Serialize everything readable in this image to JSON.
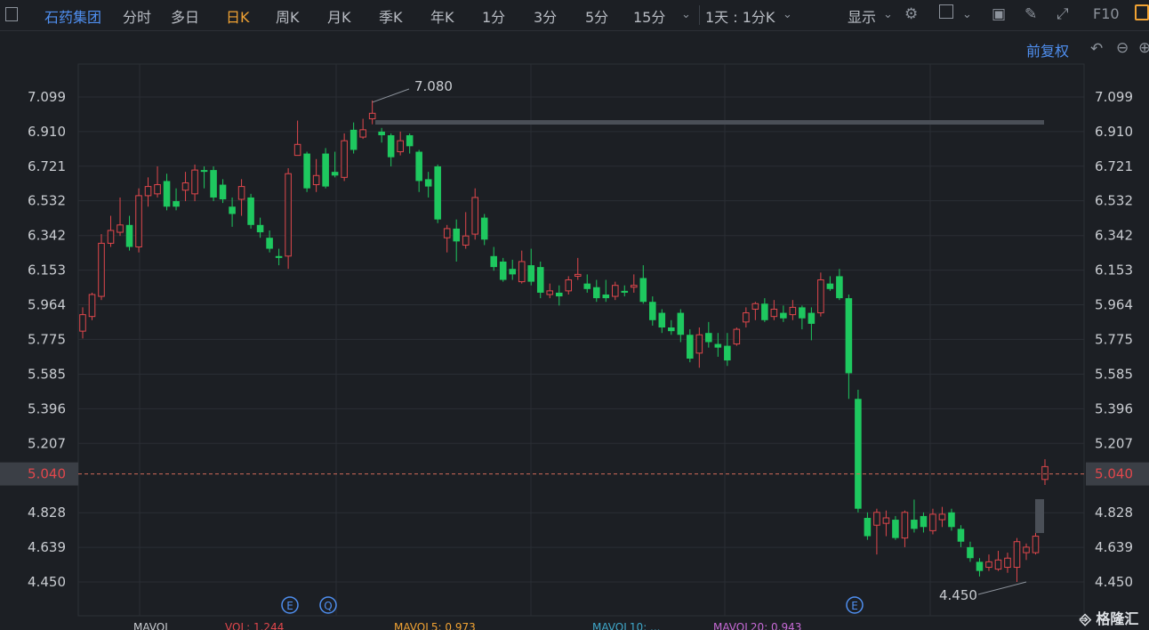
{
  "toolbar": {
    "stock_name": "石药集团",
    "tabs": [
      "分时",
      "多日",
      "日K",
      "周K",
      "月K",
      "季K",
      "年K",
      "1分",
      "3分",
      "5分",
      "15分"
    ],
    "active_tab": "日K",
    "period_select": "1天 : 1分K",
    "display_label": "显示",
    "f10_label": "F10"
  },
  "adjust_label": "前复权",
  "price_labels": [
    "7.099",
    "6.910",
    "6.721",
    "6.532",
    "6.342",
    "6.153",
    "5.964",
    "5.775",
    "5.585",
    "5.396",
    "5.207",
    "5.040",
    "4.828",
    "4.639",
    "4.450"
  ],
  "current_price": "5.040",
  "high_label": "7.080",
  "low_label": "4.450",
  "event_markers": [
    "E",
    "Q",
    "E"
  ],
  "volume_bar": {
    "mavol": "MAVOL",
    "vol": "VOL: 1.244",
    "ma5": "MAVOL5: 0.973",
    "ma10": "MAVOL10: ...",
    "ma20": "MAVOL20: 0.943"
  },
  "watermark": "格隆汇",
  "colors": {
    "up": "#e0474c",
    "down": "#1ec85f",
    "accent": "#f0a233",
    "link": "#4f8ff0"
  },
  "chart_data": {
    "type": "candlestick",
    "ylim": [
      4.35,
      7.2
    ],
    "y_ticks": [
      7.099,
      6.91,
      6.721,
      6.532,
      6.342,
      6.153,
      5.964,
      5.775,
      5.585,
      5.396,
      5.207,
      5.04,
      4.828,
      4.639,
      4.45
    ],
    "current_price": 5.04,
    "high": 7.08,
    "low": 4.45,
    "candles": [
      {
        "o": 5.82,
        "c": 5.91,
        "h": 5.95,
        "l": 5.78
      },
      {
        "o": 5.9,
        "c": 6.02,
        "h": 6.03,
        "l": 5.88
      },
      {
        "o": 6.01,
        "c": 6.3,
        "h": 6.35,
        "l": 5.99
      },
      {
        "o": 6.3,
        "c": 6.37,
        "h": 6.45,
        "l": 6.28
      },
      {
        "o": 6.36,
        "c": 6.4,
        "h": 6.55,
        "l": 6.34
      },
      {
        "o": 6.4,
        "c": 6.28,
        "h": 6.45,
        "l": 6.26
      },
      {
        "o": 6.28,
        "c": 6.56,
        "h": 6.6,
        "l": 6.25
      },
      {
        "o": 6.56,
        "c": 6.61,
        "h": 6.66,
        "l": 6.5
      },
      {
        "o": 6.57,
        "c": 6.62,
        "h": 6.72,
        "l": 6.55
      },
      {
        "o": 6.64,
        "c": 6.5,
        "h": 6.68,
        "l": 6.48
      },
      {
        "o": 6.53,
        "c": 6.5,
        "h": 6.6,
        "l": 6.48
      },
      {
        "o": 6.59,
        "c": 6.63,
        "h": 6.69,
        "l": 6.53
      },
      {
        "o": 6.57,
        "c": 6.7,
        "h": 6.73,
        "l": 6.53
      },
      {
        "o": 6.7,
        "c": 6.69,
        "h": 6.72,
        "l": 6.6
      },
      {
        "o": 6.7,
        "c": 6.55,
        "h": 6.72,
        "l": 6.53
      },
      {
        "o": 6.62,
        "c": 6.54,
        "h": 6.65,
        "l": 6.52
      },
      {
        "o": 6.5,
        "c": 6.46,
        "h": 6.55,
        "l": 6.39
      },
      {
        "o": 6.54,
        "c": 6.61,
        "h": 6.65,
        "l": 6.45
      },
      {
        "o": 6.55,
        "c": 6.4,
        "h": 6.57,
        "l": 6.38
      },
      {
        "o": 6.4,
        "c": 6.36,
        "h": 6.44,
        "l": 6.33
      },
      {
        "o": 6.33,
        "c": 6.27,
        "h": 6.37,
        "l": 6.25
      },
      {
        "o": 6.23,
        "c": 6.22,
        "h": 6.27,
        "l": 6.18
      },
      {
        "o": 6.23,
        "c": 6.68,
        "h": 6.71,
        "l": 6.16
      },
      {
        "o": 6.78,
        "c": 6.84,
        "h": 6.97,
        "l": 6.8
      },
      {
        "o": 6.79,
        "c": 6.6,
        "h": 6.8,
        "l": 6.58
      },
      {
        "o": 6.62,
        "c": 6.67,
        "h": 6.76,
        "l": 6.58
      },
      {
        "o": 6.79,
        "c": 6.61,
        "h": 6.82,
        "l": 6.6
      },
      {
        "o": 6.69,
        "c": 6.67,
        "h": 6.8,
        "l": 6.66
      },
      {
        "o": 6.66,
        "c": 6.86,
        "h": 6.9,
        "l": 6.64
      },
      {
        "o": 6.92,
        "c": 6.81,
        "h": 6.96,
        "l": 6.79
      },
      {
        "o": 6.88,
        "c": 6.92,
        "h": 6.98,
        "l": 6.87
      },
      {
        "o": 6.98,
        "c": 7.01,
        "h": 7.08,
        "l": 6.95
      },
      {
        "o": 6.91,
        "c": 6.89,
        "h": 6.93,
        "l": 6.85
      },
      {
        "o": 6.89,
        "c": 6.77,
        "h": 6.9,
        "l": 6.72
      },
      {
        "o": 6.8,
        "c": 6.86,
        "h": 6.91,
        "l": 6.78
      },
      {
        "o": 6.89,
        "c": 6.83,
        "h": 6.9,
        "l": 6.79
      },
      {
        "o": 6.8,
        "c": 6.64,
        "h": 6.81,
        "l": 6.58
      },
      {
        "o": 6.65,
        "c": 6.61,
        "h": 6.69,
        "l": 6.55
      },
      {
        "o": 6.72,
        "c": 6.43,
        "h": 6.73,
        "l": 6.41
      },
      {
        "o": 6.33,
        "c": 6.38,
        "h": 6.4,
        "l": 6.25
      },
      {
        "o": 6.38,
        "c": 6.31,
        "h": 6.43,
        "l": 6.2
      },
      {
        "o": 6.29,
        "c": 6.34,
        "h": 6.47,
        "l": 6.27
      },
      {
        "o": 6.35,
        "c": 6.55,
        "h": 6.6,
        "l": 6.32
      },
      {
        "o": 6.44,
        "c": 6.32,
        "h": 6.46,
        "l": 6.29
      },
      {
        "o": 6.23,
        "c": 6.17,
        "h": 6.28,
        "l": 6.15
      },
      {
        "o": 6.2,
        "c": 6.1,
        "h": 6.22,
        "l": 6.09
      },
      {
        "o": 6.16,
        "c": 6.13,
        "h": 6.21,
        "l": 6.1
      },
      {
        "o": 6.09,
        "c": 6.2,
        "h": 6.26,
        "l": 6.08
      },
      {
        "o": 6.18,
        "c": 6.09,
        "h": 6.27,
        "l": 6.07
      },
      {
        "o": 6.17,
        "c": 6.03,
        "h": 6.2,
        "l": 6.0
      },
      {
        "o": 6.02,
        "c": 6.04,
        "h": 6.08,
        "l": 6.0
      },
      {
        "o": 6.03,
        "c": 6.01,
        "h": 6.07,
        "l": 5.96
      },
      {
        "o": 6.04,
        "c": 6.1,
        "h": 6.12,
        "l": 6.02
      },
      {
        "o": 6.12,
        "c": 6.13,
        "h": 6.22,
        "l": 6.1
      },
      {
        "o": 6.08,
        "c": 6.05,
        "h": 6.13,
        "l": 6.03
      },
      {
        "o": 6.06,
        "c": 6.0,
        "h": 6.1,
        "l": 5.98
      },
      {
        "o": 6.02,
        "c": 6.0,
        "h": 6.1,
        "l": 5.98
      },
      {
        "o": 6.01,
        "c": 6.07,
        "h": 6.09,
        "l": 5.99
      },
      {
        "o": 6.04,
        "c": 6.03,
        "h": 6.07,
        "l": 6.01
      },
      {
        "o": 6.06,
        "c": 6.07,
        "h": 6.13,
        "l": 6.03
      },
      {
        "o": 6.11,
        "c": 5.98,
        "h": 6.18,
        "l": 5.97
      },
      {
        "o": 5.98,
        "c": 5.88,
        "h": 6.01,
        "l": 5.85
      },
      {
        "o": 5.92,
        "c": 5.84,
        "h": 5.94,
        "l": 5.81
      },
      {
        "o": 5.84,
        "c": 5.82,
        "h": 5.88,
        "l": 5.8
      },
      {
        "o": 5.92,
        "c": 5.8,
        "h": 5.94,
        "l": 5.76
      },
      {
        "o": 5.8,
        "c": 5.67,
        "h": 5.83,
        "l": 5.65
      },
      {
        "o": 5.7,
        "c": 5.8,
        "h": 5.84,
        "l": 5.62
      },
      {
        "o": 5.81,
        "c": 5.76,
        "h": 5.87,
        "l": 5.73
      },
      {
        "o": 5.75,
        "c": 5.73,
        "h": 5.81,
        "l": 5.68
      },
      {
        "o": 5.74,
        "c": 5.66,
        "h": 5.81,
        "l": 5.63
      },
      {
        "o": 5.75,
        "c": 5.83,
        "h": 5.84,
        "l": 5.74
      },
      {
        "o": 5.87,
        "c": 5.92,
        "h": 5.95,
        "l": 5.84
      },
      {
        "o": 5.94,
        "c": 5.97,
        "h": 5.98,
        "l": 5.88
      },
      {
        "o": 5.97,
        "c": 5.88,
        "h": 6.0,
        "l": 5.87
      },
      {
        "o": 5.9,
        "c": 5.94,
        "h": 5.99,
        "l": 5.88
      },
      {
        "o": 5.92,
        "c": 5.89,
        "h": 5.96,
        "l": 5.87
      },
      {
        "o": 5.91,
        "c": 5.95,
        "h": 5.99,
        "l": 5.88
      },
      {
        "o": 5.95,
        "c": 5.89,
        "h": 5.96,
        "l": 5.83
      },
      {
        "o": 5.92,
        "c": 5.86,
        "h": 5.95,
        "l": 5.77
      },
      {
        "o": 5.92,
        "c": 6.1,
        "h": 6.14,
        "l": 5.9
      },
      {
        "o": 6.08,
        "c": 6.05,
        "h": 6.12,
        "l": 6.04
      },
      {
        "o": 6.12,
        "c": 6.0,
        "h": 6.16,
        "l": 5.99
      },
      {
        "o": 6.0,
        "c": 5.59,
        "h": 6.02,
        "l": 5.45
      },
      {
        "o": 5.45,
        "c": 4.85,
        "h": 5.5,
        "l": 4.83
      },
      {
        "o": 4.8,
        "c": 4.7,
        "h": 4.83,
        "l": 4.68
      },
      {
        "o": 4.76,
        "c": 4.83,
        "h": 4.85,
        "l": 4.6
      },
      {
        "o": 4.77,
        "c": 4.8,
        "h": 4.84,
        "l": 4.7
      },
      {
        "o": 4.79,
        "c": 4.69,
        "h": 4.81,
        "l": 4.68
      },
      {
        "o": 4.69,
        "c": 4.83,
        "h": 4.84,
        "l": 4.64
      },
      {
        "o": 4.79,
        "c": 4.74,
        "h": 4.9,
        "l": 4.72
      },
      {
        "o": 4.81,
        "c": 4.75,
        "h": 4.83,
        "l": 4.72
      },
      {
        "o": 4.73,
        "c": 4.82,
        "h": 4.85,
        "l": 4.71
      },
      {
        "o": 4.79,
        "c": 4.82,
        "h": 4.86,
        "l": 4.75
      },
      {
        "o": 4.83,
        "c": 4.75,
        "h": 4.85,
        "l": 4.73
      },
      {
        "o": 4.74,
        "c": 4.67,
        "h": 4.76,
        "l": 4.64
      },
      {
        "o": 4.64,
        "c": 4.58,
        "h": 4.67,
        "l": 4.56
      },
      {
        "o": 4.56,
        "c": 4.51,
        "h": 4.58,
        "l": 4.48
      },
      {
        "o": 4.53,
        "c": 4.56,
        "h": 4.6,
        "l": 4.51
      },
      {
        "o": 4.52,
        "c": 4.57,
        "h": 4.62,
        "l": 4.51
      },
      {
        "o": 4.53,
        "c": 4.58,
        "h": 4.61,
        "l": 4.5
      },
      {
        "o": 4.53,
        "c": 4.67,
        "h": 4.69,
        "l": 4.45
      },
      {
        "o": 4.61,
        "c": 4.64,
        "h": 4.66,
        "l": 4.57
      },
      {
        "o": 4.61,
        "c": 4.7,
        "h": 4.72,
        "l": 4.6
      },
      {
        "o": 5.01,
        "c": 5.08,
        "h": 5.12,
        "l": 4.98
      }
    ]
  }
}
